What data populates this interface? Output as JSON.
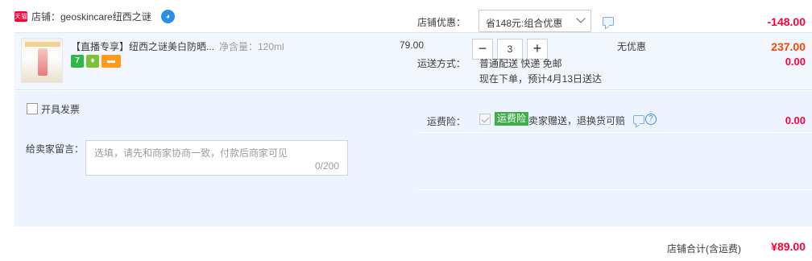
{
  "shop": {
    "badge": "天猫",
    "label": "店铺：geoskincare纽西之谜",
    "chat_icon": "wangwang-chat-icon"
  },
  "item": {
    "title": "【直播专享】纽西之谜美白防晒...",
    "spec": "净含量：120ml",
    "unit_price": "79.00",
    "quantity": "3",
    "qty_minus": "−",
    "qty_plus": "+",
    "discount": "无优惠",
    "line_total": "237.00",
    "badges": [
      "7",
      "safe-icon",
      "card-icon"
    ]
  },
  "options": {
    "invoice_label": "开具发票",
    "note_label": "给卖家留言：",
    "note_placeholder": "选填，请先和商家协商一致，付款后商家可见",
    "note_count": "0/200"
  },
  "promo": {
    "label": "店铺优惠：",
    "selected": "省148元:组合优惠",
    "amount": "-148.00"
  },
  "shipping": {
    "label": "运送方式：",
    "line1": "普通配送 快递 免邮",
    "line2": "现在下单，预计4月13日送达",
    "amount": "0.00"
  },
  "insurance": {
    "label": "运费险：",
    "tag": "运费险",
    "text": "卖家赠送，退换货可赔",
    "help": "?",
    "amount": "0.00"
  },
  "total": {
    "label": "店铺合计(含运费)",
    "amount": "¥89.00"
  },
  "colors": {
    "accent_red": "#ff0036",
    "price_orange": "#ff4400",
    "row_bg": "#f2f7ff",
    "panel_bg": "#eef4ff",
    "insurance_green": "#3fae49"
  }
}
